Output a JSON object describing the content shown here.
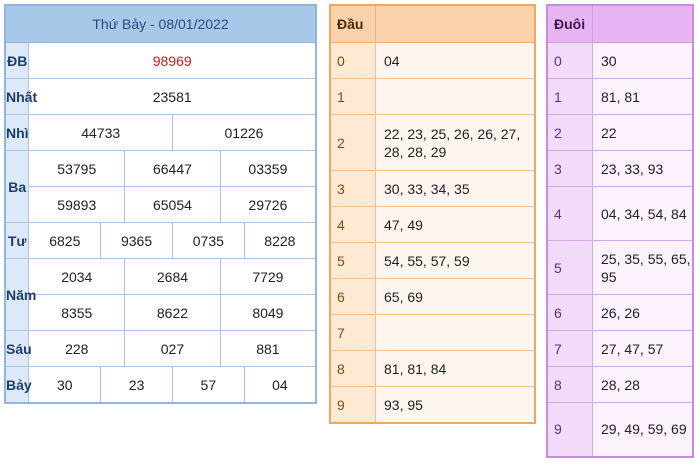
{
  "results": {
    "title": "Thứ Bảy - 08/01/2022",
    "db_label": "ĐB",
    "db": "98969",
    "nhat_label": "Nhất",
    "nhat": "23581",
    "nhi_label": "Nhì",
    "nhi": [
      "44733",
      "01226"
    ],
    "ba_label": "Ba",
    "ba": [
      "53795",
      "66447",
      "03359",
      "59893",
      "65054",
      "29726"
    ],
    "tu_label": "Tư",
    "tu": [
      "6825",
      "9365",
      "0735",
      "8228"
    ],
    "nam_label": "Năm",
    "nam": [
      "2034",
      "2684",
      "7729",
      "8355",
      "8622",
      "8049"
    ],
    "sau_label": "Sáu",
    "sau": [
      "228",
      "027",
      "881"
    ],
    "bay_label": "Bảy",
    "bay": [
      "30",
      "23",
      "57",
      "04"
    ]
  },
  "dau": {
    "header": "Đầu",
    "rows": [
      {
        "k": "0",
        "v": "04"
      },
      {
        "k": "1",
        "v": ""
      },
      {
        "k": "2",
        "v": "22, 23, 25, 26, 26, 27, 28, 28, 29"
      },
      {
        "k": "3",
        "v": "30, 33, 34, 35"
      },
      {
        "k": "4",
        "v": "47, 49"
      },
      {
        "k": "5",
        "v": "54, 55, 57, 59"
      },
      {
        "k": "6",
        "v": "65, 69"
      },
      {
        "k": "7",
        "v": ""
      },
      {
        "k": "8",
        "v": "81, 81, 84"
      },
      {
        "k": "9",
        "v": "93, 95"
      }
    ]
  },
  "duoi": {
    "header": "Đuôi",
    "rows": [
      {
        "k": "0",
        "v": "30"
      },
      {
        "k": "1",
        "v": "81, 81"
      },
      {
        "k": "2",
        "v": "22"
      },
      {
        "k": "3",
        "v": "23, 33, 93"
      },
      {
        "k": "4",
        "v": "04, 34, 54, 84"
      },
      {
        "k": "5",
        "v": "25, 35, 55, 65, 95"
      },
      {
        "k": "6",
        "v": "26, 26"
      },
      {
        "k": "7",
        "v": "27, 47, 57"
      },
      {
        "k": "8",
        "v": "28, 28"
      },
      {
        "k": "9",
        "v": "29, 49, 59, 69"
      }
    ]
  }
}
